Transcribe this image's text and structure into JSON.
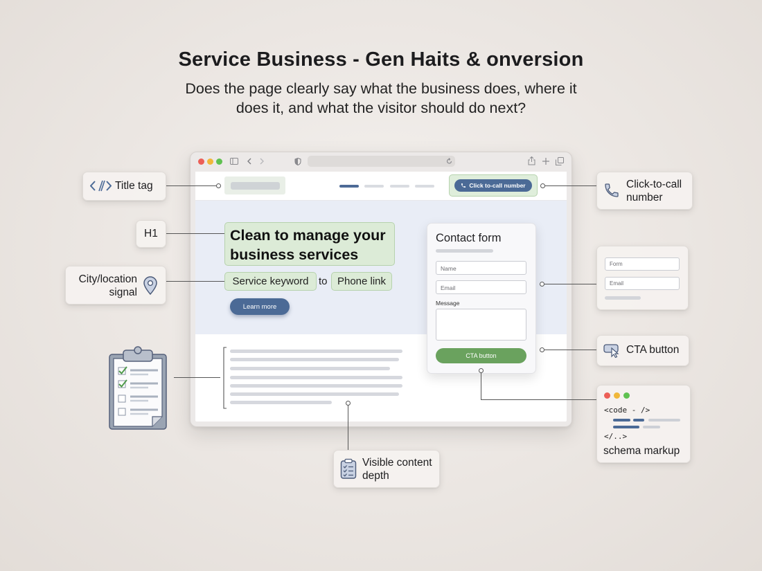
{
  "header": {
    "title": "Service Business - Gen Haits & onversion",
    "subtitle": "Does the page clearly say what the business does, where it does it, and what the visitor should do next?"
  },
  "mockup": {
    "call_button": "Click to-call number",
    "h1": "Clean to manage your business services",
    "service_keyword": "Service keyword",
    "connector": "to",
    "phone_link": "Phone link",
    "learn_more": "Learn more",
    "contact_form": {
      "title": "Contact form",
      "name_placeholder": "Name",
      "email_placeholder": "Email",
      "message_label": "Message",
      "cta": "CTA button"
    }
  },
  "callouts": {
    "title_tag": "Title tag",
    "h1": "H1",
    "city_location": "City/location signal",
    "click_to_call": "Click-to-call number",
    "form_field": "Form",
    "email_field": "Email",
    "cta_button": "CTA button",
    "code_open": "<code - />",
    "code_close": "</..>",
    "schema_markup": "schema markup",
    "visible_content": "Visible content depth"
  },
  "icons": {
    "title_tag": "code-icon",
    "city": "map-pin-icon",
    "call": "phone-icon",
    "cta": "pointer-button-icon",
    "content": "clipboard-checklist-icon",
    "checklist": "checklist-clipboard-icon"
  },
  "colors": {
    "accent_blue": "#4b6a96",
    "accent_green": "#6aa25e",
    "highlight_green": "#dcebd7",
    "hero_bg": "#e9edf6"
  }
}
